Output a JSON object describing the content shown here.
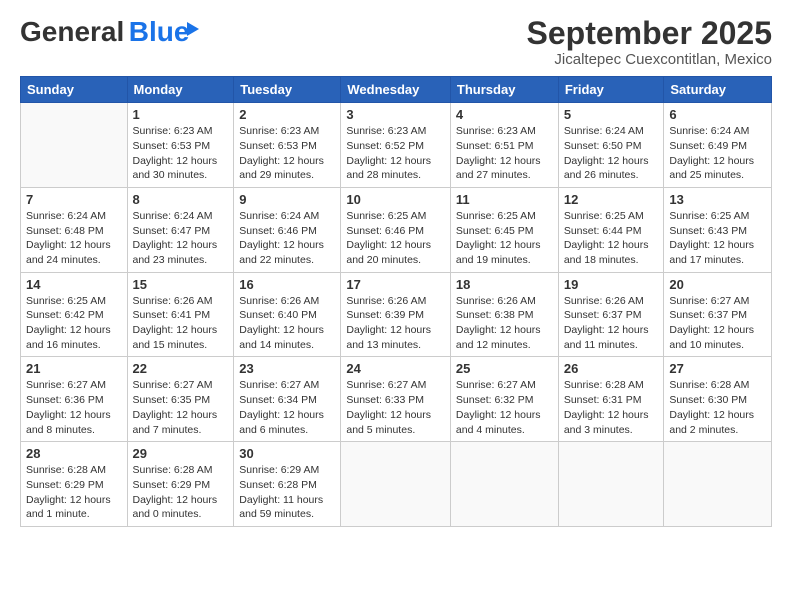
{
  "logo": {
    "text1": "General",
    "text2": "Blue"
  },
  "title": "September 2025",
  "subtitle": "Jicaltepec Cuexcontitlan, Mexico",
  "days": [
    "Sunday",
    "Monday",
    "Tuesday",
    "Wednesday",
    "Thursday",
    "Friday",
    "Saturday"
  ],
  "weeks": [
    [
      {
        "day": "",
        "sunrise": "",
        "sunset": "",
        "daylight": ""
      },
      {
        "day": "1",
        "sunrise": "Sunrise: 6:23 AM",
        "sunset": "Sunset: 6:53 PM",
        "daylight": "Daylight: 12 hours and 30 minutes."
      },
      {
        "day": "2",
        "sunrise": "Sunrise: 6:23 AM",
        "sunset": "Sunset: 6:53 PM",
        "daylight": "Daylight: 12 hours and 29 minutes."
      },
      {
        "day": "3",
        "sunrise": "Sunrise: 6:23 AM",
        "sunset": "Sunset: 6:52 PM",
        "daylight": "Daylight: 12 hours and 28 minutes."
      },
      {
        "day": "4",
        "sunrise": "Sunrise: 6:23 AM",
        "sunset": "Sunset: 6:51 PM",
        "daylight": "Daylight: 12 hours and 27 minutes."
      },
      {
        "day": "5",
        "sunrise": "Sunrise: 6:24 AM",
        "sunset": "Sunset: 6:50 PM",
        "daylight": "Daylight: 12 hours and 26 minutes."
      },
      {
        "day": "6",
        "sunrise": "Sunrise: 6:24 AM",
        "sunset": "Sunset: 6:49 PM",
        "daylight": "Daylight: 12 hours and 25 minutes."
      }
    ],
    [
      {
        "day": "7",
        "sunrise": "Sunrise: 6:24 AM",
        "sunset": "Sunset: 6:48 PM",
        "daylight": "Daylight: 12 hours and 24 minutes."
      },
      {
        "day": "8",
        "sunrise": "Sunrise: 6:24 AM",
        "sunset": "Sunset: 6:47 PM",
        "daylight": "Daylight: 12 hours and 23 minutes."
      },
      {
        "day": "9",
        "sunrise": "Sunrise: 6:24 AM",
        "sunset": "Sunset: 6:46 PM",
        "daylight": "Daylight: 12 hours and 22 minutes."
      },
      {
        "day": "10",
        "sunrise": "Sunrise: 6:25 AM",
        "sunset": "Sunset: 6:46 PM",
        "daylight": "Daylight: 12 hours and 20 minutes."
      },
      {
        "day": "11",
        "sunrise": "Sunrise: 6:25 AM",
        "sunset": "Sunset: 6:45 PM",
        "daylight": "Daylight: 12 hours and 19 minutes."
      },
      {
        "day": "12",
        "sunrise": "Sunrise: 6:25 AM",
        "sunset": "Sunset: 6:44 PM",
        "daylight": "Daylight: 12 hours and 18 minutes."
      },
      {
        "day": "13",
        "sunrise": "Sunrise: 6:25 AM",
        "sunset": "Sunset: 6:43 PM",
        "daylight": "Daylight: 12 hours and 17 minutes."
      }
    ],
    [
      {
        "day": "14",
        "sunrise": "Sunrise: 6:25 AM",
        "sunset": "Sunset: 6:42 PM",
        "daylight": "Daylight: 12 hours and 16 minutes."
      },
      {
        "day": "15",
        "sunrise": "Sunrise: 6:26 AM",
        "sunset": "Sunset: 6:41 PM",
        "daylight": "Daylight: 12 hours and 15 minutes."
      },
      {
        "day": "16",
        "sunrise": "Sunrise: 6:26 AM",
        "sunset": "Sunset: 6:40 PM",
        "daylight": "Daylight: 12 hours and 14 minutes."
      },
      {
        "day": "17",
        "sunrise": "Sunrise: 6:26 AM",
        "sunset": "Sunset: 6:39 PM",
        "daylight": "Daylight: 12 hours and 13 minutes."
      },
      {
        "day": "18",
        "sunrise": "Sunrise: 6:26 AM",
        "sunset": "Sunset: 6:38 PM",
        "daylight": "Daylight: 12 hours and 12 minutes."
      },
      {
        "day": "19",
        "sunrise": "Sunrise: 6:26 AM",
        "sunset": "Sunset: 6:37 PM",
        "daylight": "Daylight: 12 hours and 11 minutes."
      },
      {
        "day": "20",
        "sunrise": "Sunrise: 6:27 AM",
        "sunset": "Sunset: 6:37 PM",
        "daylight": "Daylight: 12 hours and 10 minutes."
      }
    ],
    [
      {
        "day": "21",
        "sunrise": "Sunrise: 6:27 AM",
        "sunset": "Sunset: 6:36 PM",
        "daylight": "Daylight: 12 hours and 8 minutes."
      },
      {
        "day": "22",
        "sunrise": "Sunrise: 6:27 AM",
        "sunset": "Sunset: 6:35 PM",
        "daylight": "Daylight: 12 hours and 7 minutes."
      },
      {
        "day": "23",
        "sunrise": "Sunrise: 6:27 AM",
        "sunset": "Sunset: 6:34 PM",
        "daylight": "Daylight: 12 hours and 6 minutes."
      },
      {
        "day": "24",
        "sunrise": "Sunrise: 6:27 AM",
        "sunset": "Sunset: 6:33 PM",
        "daylight": "Daylight: 12 hours and 5 minutes."
      },
      {
        "day": "25",
        "sunrise": "Sunrise: 6:27 AM",
        "sunset": "Sunset: 6:32 PM",
        "daylight": "Daylight: 12 hours and 4 minutes."
      },
      {
        "day": "26",
        "sunrise": "Sunrise: 6:28 AM",
        "sunset": "Sunset: 6:31 PM",
        "daylight": "Daylight: 12 hours and 3 minutes."
      },
      {
        "day": "27",
        "sunrise": "Sunrise: 6:28 AM",
        "sunset": "Sunset: 6:30 PM",
        "daylight": "Daylight: 12 hours and 2 minutes."
      }
    ],
    [
      {
        "day": "28",
        "sunrise": "Sunrise: 6:28 AM",
        "sunset": "Sunset: 6:29 PM",
        "daylight": "Daylight: 12 hours and 1 minute."
      },
      {
        "day": "29",
        "sunrise": "Sunrise: 6:28 AM",
        "sunset": "Sunset: 6:29 PM",
        "daylight": "Daylight: 12 hours and 0 minutes."
      },
      {
        "day": "30",
        "sunrise": "Sunrise: 6:29 AM",
        "sunset": "Sunset: 6:28 PM",
        "daylight": "Daylight: 11 hours and 59 minutes."
      },
      {
        "day": "",
        "sunrise": "",
        "sunset": "",
        "daylight": ""
      },
      {
        "day": "",
        "sunrise": "",
        "sunset": "",
        "daylight": ""
      },
      {
        "day": "",
        "sunrise": "",
        "sunset": "",
        "daylight": ""
      },
      {
        "day": "",
        "sunrise": "",
        "sunset": "",
        "daylight": ""
      }
    ]
  ]
}
